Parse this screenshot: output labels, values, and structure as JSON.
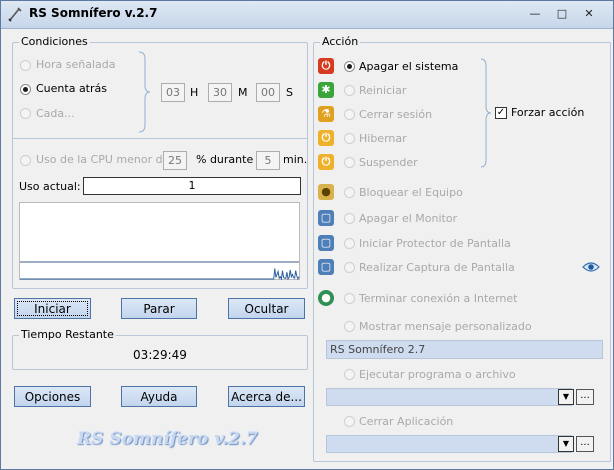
{
  "window": {
    "title": "RS Somnífero v.2.7"
  },
  "conditions": {
    "legend": "Condiciones",
    "hora_label": "Hora señalada",
    "cuenta_label": "Cuenta atrás",
    "cada_label": "Cada...",
    "hours": "03",
    "h_unit": "H",
    "minutes": "30",
    "m_unit": "M",
    "seconds": "00",
    "s_unit": "S",
    "cpu_label": "Uso de la CPU menor de:",
    "cpu_value": "25",
    "cpu_during": "% durante",
    "cpu_minutes": "5",
    "cpu_min_unit": "min.",
    "usage_label": "Uso actual:",
    "usage_value": "1"
  },
  "buttons": {
    "iniciar": "Iniciar",
    "parar": "Parar",
    "ocultar": "Ocultar",
    "opciones": "Opciones",
    "ayuda": "Ayuda",
    "acerca": "Acerca de..."
  },
  "remaining": {
    "legend": "Tiempo Restante",
    "value": "03:29:49"
  },
  "logo": "RS Somnífero v.2.7",
  "action": {
    "legend": "Acción",
    "items": [
      "Apagar el sistema",
      "Reiniciar",
      "Cerrar sesión",
      "Hibernar",
      "Suspender",
      "Bloquear el Equipo",
      "Apagar el Monitor",
      "Iniciar Protector de Pantalla",
      "Realizar Captura de Pantalla",
      "Terminar conexión a Internet",
      "Mostrar mensaje personalizado",
      "Ejecutar programa o archivo",
      "Cerrar Aplicación"
    ],
    "force_label": "Forzar acción",
    "message_value": "RS Somnífero 2.7",
    "dots": "..."
  },
  "chart_data": {
    "type": "line",
    "title": "",
    "xlabel": "",
    "ylabel": "",
    "ylim": [
      0,
      100
    ],
    "series": [
      {
        "values": [
          0,
          0,
          0,
          0,
          0,
          0,
          0,
          0,
          0,
          0,
          0,
          0,
          0,
          0,
          0,
          0,
          0,
          0,
          0,
          0,
          0,
          0,
          0,
          0,
          0,
          0,
          0,
          0,
          0,
          0,
          0,
          0,
          0,
          0,
          0,
          0,
          0,
          0,
          0,
          0,
          0,
          0,
          0,
          0,
          0,
          0,
          0,
          0,
          0,
          0,
          0,
          0,
          0,
          0,
          0,
          0,
          0,
          0,
          0,
          0,
          0,
          0,
          0,
          0,
          0,
          0,
          0,
          0,
          0,
          0,
          0,
          0,
          0,
          0,
          0,
          0,
          0,
          0,
          0,
          0,
          0,
          0,
          0,
          0,
          0,
          0,
          0,
          0,
          0,
          0,
          0,
          0,
          0,
          0,
          0,
          0,
          0,
          0,
          0,
          0,
          0,
          0,
          0,
          0,
          0,
          0,
          0,
          0,
          0,
          0,
          0,
          0,
          0,
          0,
          0,
          0,
          0,
          0,
          0,
          0,
          0,
          0,
          0,
          0,
          0,
          0,
          0,
          0,
          0,
          0,
          0,
          0,
          0,
          0,
          0,
          0,
          0,
          0,
          0,
          0,
          0,
          0,
          0,
          0,
          0,
          0,
          0,
          0,
          0,
          0,
          0,
          0,
          0,
          0,
          0,
          0,
          0,
          0,
          0,
          0,
          0,
          0,
          0,
          0,
          0,
          0,
          0,
          0,
          0,
          0,
          0,
          0,
          0,
          0,
          0,
          0,
          0,
          0,
          0,
          0,
          0,
          0,
          0,
          0,
          0,
          0,
          0,
          0,
          0,
          0,
          0,
          0,
          0,
          0,
          0,
          0,
          0,
          0,
          0,
          0,
          0,
          0,
          0,
          0,
          0,
          0,
          0,
          0,
          0,
          0,
          0,
          0,
          0,
          0,
          0,
          0,
          0,
          0,
          0,
          0,
          0,
          0,
          0,
          0,
          0,
          0,
          0,
          0,
          0,
          0,
          0,
          0,
          14,
          2,
          6,
          10,
          1,
          3,
          0,
          11,
          2,
          1,
          1,
          9,
          0,
          2,
          12,
          3,
          6,
          2,
          1,
          11,
          4,
          0,
          3
        ]
      }
    ]
  }
}
